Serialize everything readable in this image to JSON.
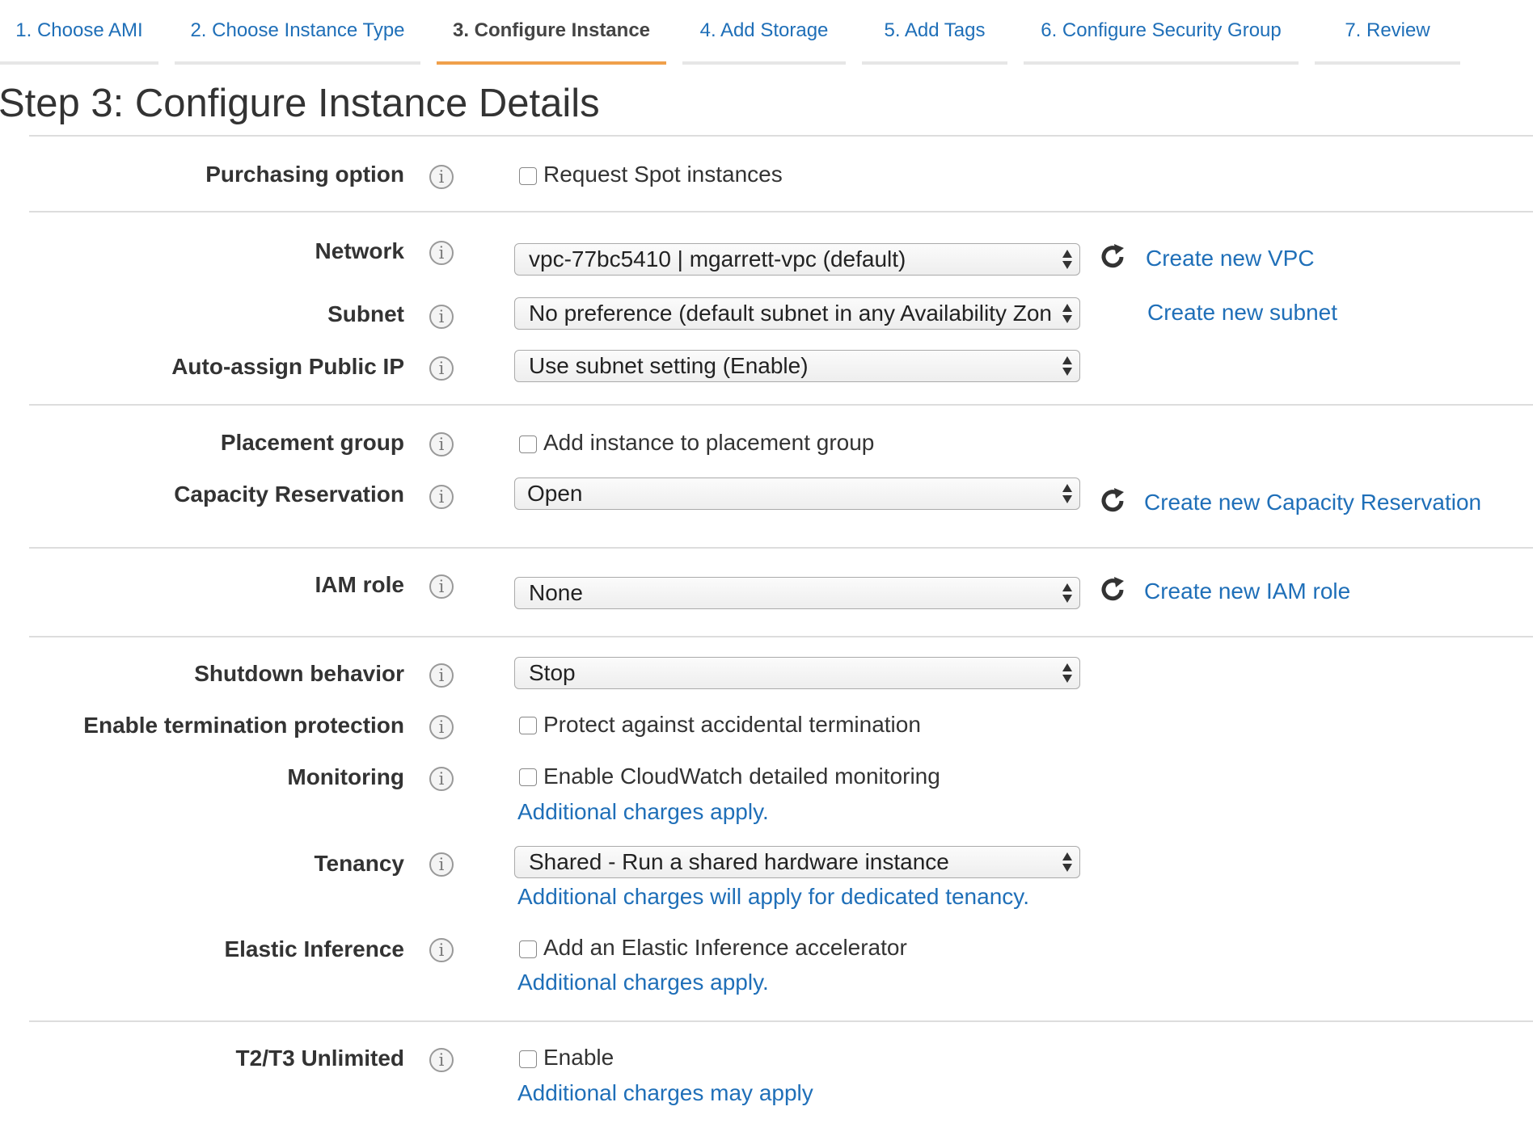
{
  "tabs": [
    {
      "label": "1. Choose AMI",
      "active": false
    },
    {
      "label": "2. Choose Instance Type",
      "active": false
    },
    {
      "label": "3. Configure Instance",
      "active": true
    },
    {
      "label": "4. Add Storage",
      "active": false
    },
    {
      "label": "5. Add Tags",
      "active": false
    },
    {
      "label": "6. Configure Security Group",
      "active": false
    },
    {
      "label": "7. Review",
      "active": false
    }
  ],
  "page_title": "Step 3: Configure Instance Details",
  "colors": {
    "link": "#1f6fb8",
    "active_tab_underline": "#f0a04b",
    "divider": "#dddddd"
  },
  "fields": {
    "purchasing_option": {
      "label": "Purchasing option",
      "checkbox_label": "Request Spot instances",
      "checked": false
    },
    "network": {
      "label": "Network",
      "value": "vpc-77bc5410 | mgarrett-vpc (default)",
      "link": "Create new VPC"
    },
    "subnet": {
      "label": "Subnet",
      "value": "No preference (default subnet in any Availability Zon",
      "link": "Create new subnet"
    },
    "auto_assign_ip": {
      "label": "Auto-assign Public IP",
      "value": "Use subnet setting (Enable)"
    },
    "placement_group": {
      "label": "Placement group",
      "checkbox_label": "Add instance to placement group",
      "checked": false
    },
    "capacity_reservation": {
      "label": "Capacity Reservation",
      "value": "Open",
      "link": "Create new Capacity Reservation"
    },
    "iam_role": {
      "label": "IAM role",
      "value": "None",
      "link": "Create new IAM role"
    },
    "shutdown_behavior": {
      "label": "Shutdown behavior",
      "value": "Stop"
    },
    "termination_protection": {
      "label": "Enable termination protection",
      "checkbox_label": "Protect against accidental termination",
      "checked": false
    },
    "monitoring": {
      "label": "Monitoring",
      "checkbox_label": "Enable CloudWatch detailed monitoring",
      "checked": false,
      "note": "Additional charges apply."
    },
    "tenancy": {
      "label": "Tenancy",
      "value": "Shared - Run a shared hardware instance",
      "note": "Additional charges will apply for dedicated tenancy."
    },
    "elastic_inference": {
      "label": "Elastic Inference",
      "checkbox_label": "Add an Elastic Inference accelerator",
      "checked": false,
      "note": "Additional charges apply."
    },
    "t2t3_unlimited": {
      "label": "T2/T3 Unlimited",
      "checkbox_label": "Enable",
      "checked": false,
      "note": "Additional charges may apply"
    }
  },
  "icons": {
    "info": "info-icon",
    "refresh": "refresh-icon",
    "select_arrows": "select-arrows-icon"
  }
}
